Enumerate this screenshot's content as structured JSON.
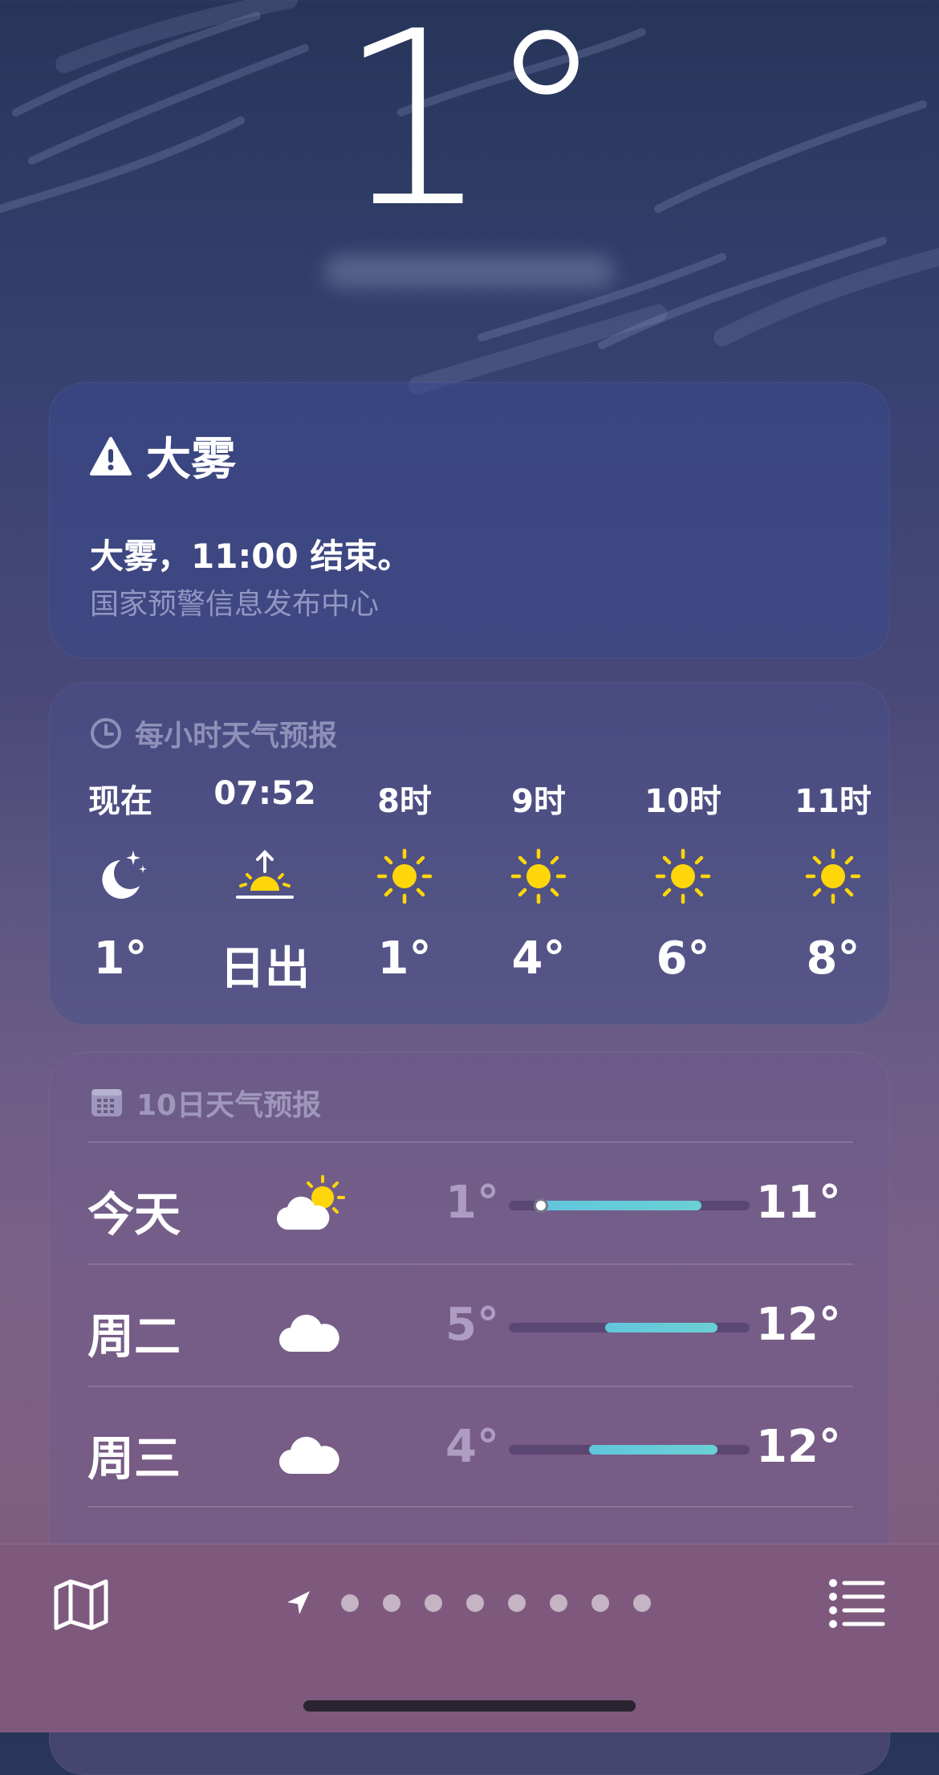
{
  "current": {
    "temperature": "1°"
  },
  "alert": {
    "icon": "warning-triangle-icon",
    "title": "大雾",
    "message": "大雾，11:00 结束。",
    "source": "国家预警信息发布中心"
  },
  "hourly": {
    "icon": "clock-icon",
    "title": "每小时天气预报",
    "items": [
      {
        "label": "现在",
        "icon": "moon-stars-icon",
        "value": "1°"
      },
      {
        "label": "07:52",
        "icon": "sunrise-icon",
        "value": "日出"
      },
      {
        "label": "8时",
        "icon": "sun-icon",
        "value": "1°"
      },
      {
        "label": "9时",
        "icon": "sun-icon",
        "value": "4°"
      },
      {
        "label": "10时",
        "icon": "sun-icon",
        "value": "6°"
      },
      {
        "label": "11时",
        "icon": "sun-icon",
        "value": "8°"
      }
    ]
  },
  "daily": {
    "icon": "calendar-icon",
    "title": "10日天气预报",
    "range_min": -1,
    "range_max": 14,
    "current_temp": 1,
    "days": [
      {
        "name": "今天",
        "icon": "partly-sunny-icon",
        "low": "1°",
        "high": "11°",
        "low_value": 1,
        "high_value": 11,
        "show_current": true
      },
      {
        "name": "周二",
        "icon": "cloud-icon",
        "low": "5°",
        "high": "12°",
        "low_value": 5,
        "high_value": 12,
        "show_current": false
      },
      {
        "name": "周三",
        "icon": "cloud-icon",
        "low": "4°",
        "high": "12°",
        "low_value": 4,
        "high_value": 12,
        "show_current": false
      }
    ]
  },
  "bottom_bar": {
    "map_icon": "map-icon",
    "list_icon": "list-icon",
    "location_icon": "location-arrow-icon",
    "page_count": 8
  },
  "colors": {
    "sun": "#ffd60a",
    "range_fill": "#62c6dd",
    "bar_background": "#7e597d"
  }
}
